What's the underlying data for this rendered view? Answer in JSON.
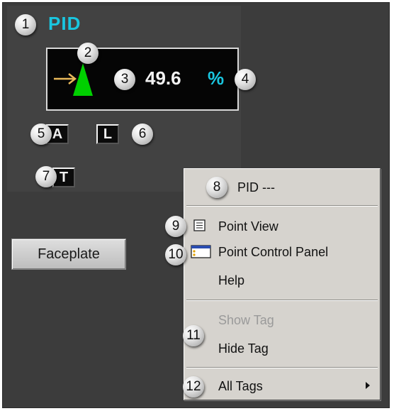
{
  "faceplate_widget": {
    "title": "PID",
    "value": "49.6",
    "unit": "%",
    "mode_buttons": [
      "A",
      "L",
      "T"
    ],
    "faceplate_button_label": "Faceplate",
    "colors": {
      "accent": "#19c6e0",
      "indicator": "#00d000",
      "arrow": "#e8b85a"
    }
  },
  "context_menu": {
    "header": "PID ---",
    "items": [
      {
        "label": "Point View",
        "icon": "point-view-icon"
      },
      {
        "label": "Point Control Panel",
        "icon": "control-panel-icon"
      },
      {
        "label": "Help"
      },
      {
        "label": "Show Tag",
        "disabled": true
      },
      {
        "label": "Hide Tag"
      },
      {
        "label": "All Tags",
        "submenu": true
      }
    ]
  },
  "callouts": [
    "1",
    "2",
    "3",
    "4",
    "5",
    "6",
    "7",
    "8",
    "9",
    "10",
    "11",
    "12"
  ]
}
